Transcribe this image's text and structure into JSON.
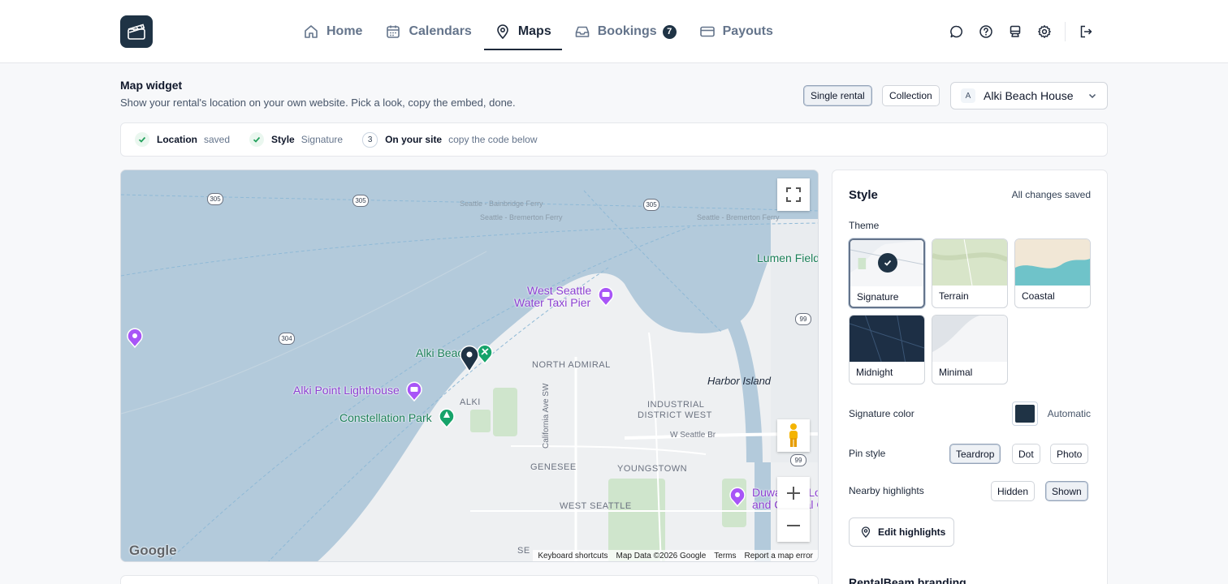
{
  "nav": {
    "logo_icon": "clapperboard-icon",
    "items": [
      {
        "label": "Home",
        "icon": "home-icon"
      },
      {
        "label": "Calendars",
        "icon": "calendar-icon"
      },
      {
        "label": "Maps",
        "icon": "map-pin-icon",
        "active": true
      },
      {
        "label": "Bookings",
        "icon": "inbox-icon",
        "badge": "7"
      },
      {
        "label": "Payouts",
        "icon": "credit-card-icon"
      }
    ],
    "right_icons": [
      "chat-icon",
      "help-icon",
      "monitor-icon",
      "gear-icon",
      "logout-icon"
    ]
  },
  "header": {
    "title": "Map widget",
    "subtitle": "Show your rental's location on your own website. Pick a look, copy the embed, done.",
    "mode_single": "Single rental",
    "mode_collection": "Collection",
    "rental_avatar": "A",
    "rental_name": "Alki Beach House"
  },
  "steps": [
    {
      "label": "Location",
      "status": "saved",
      "state": "done"
    },
    {
      "label": "Style",
      "status": "Signature",
      "state": "done"
    },
    {
      "number": "3",
      "label": "On your site",
      "status": "copy the code below",
      "state": "todo"
    }
  ],
  "map": {
    "ferries": [
      "Seattle - Bainbridge Ferry",
      "Seattle - Bremerton Ferry",
      "Seattle - Bremerton Ferry"
    ],
    "highways": [
      "305",
      "305",
      "305",
      "304",
      "99",
      "99"
    ],
    "places": {
      "lumen": "Lumen Field",
      "water_taxi_1": "West Seattle",
      "water_taxi_2": "Water Taxi Pier",
      "alki_beach": "Alki Beach",
      "lighthouse": "Alki Point Lighthouse",
      "constellation": "Constellation Park",
      "north_admiral": "NORTH ADMIRAL",
      "alki": "ALKI",
      "harbor_island": "Harbor Island",
      "industrial_1": "INDUSTRIAL",
      "industrial_2": "DISTRICT WEST",
      "genesee": "GENESEE",
      "youngstown": "YOUNGSTOWN",
      "west_seattle": "WEST SEATTLE",
      "california": "California Ave SW",
      "seattle_bridge": "W Seattle Br",
      "duwamish_1": "Duwamish Lo",
      "duwamish_2": "and Cultural C",
      "se": "SE"
    },
    "google": "Google",
    "attribution": {
      "shortcuts": "Keyboard shortcuts",
      "data": "Map Data ©2026 Google",
      "terms": "Terms",
      "report": "Report a map error"
    }
  },
  "style_panel": {
    "title": "Style",
    "saved": "All changes saved",
    "theme_label": "Theme",
    "themes": [
      {
        "name": "Signature",
        "selected": true
      },
      {
        "name": "Terrain"
      },
      {
        "name": "Coastal"
      },
      {
        "name": "Midnight"
      },
      {
        "name": "Minimal"
      }
    ],
    "color_label": "Signature color",
    "color_value": "#1f3345",
    "color_mode": "Automatic",
    "pin_label": "Pin style",
    "pin_options": [
      "Teardrop",
      "Dot",
      "Photo"
    ],
    "pin_selected": "Teardrop",
    "highlights_label": "Nearby highlights",
    "highlights_options": [
      "Hidden",
      "Shown"
    ],
    "highlights_selected": "Shown",
    "edit_highlights": "Edit highlights",
    "branding_title": "RentalBeam branding"
  }
}
